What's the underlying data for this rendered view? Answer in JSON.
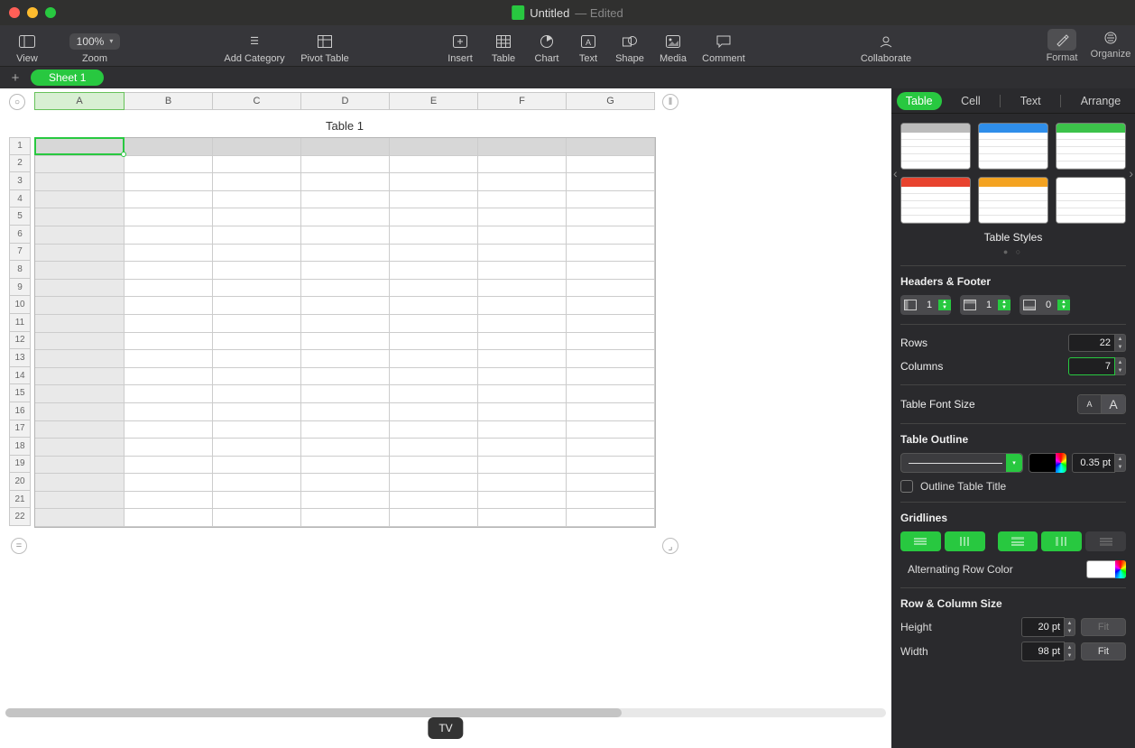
{
  "titlebar": {
    "doc_name": "Untitled",
    "status": "— Edited"
  },
  "toolbar": {
    "view": "View",
    "zoom_label": "Zoom",
    "zoom_value": "100%",
    "add_category": "Add Category",
    "pivot_table": "Pivot Table",
    "insert": "Insert",
    "table": "Table",
    "chart": "Chart",
    "text": "Text",
    "shape": "Shape",
    "media": "Media",
    "comment": "Comment",
    "collaborate": "Collaborate",
    "format": "Format",
    "organize": "Organize"
  },
  "sheets": {
    "active": "Sheet 1"
  },
  "spreadsheet": {
    "title": "Table 1",
    "columns": [
      "A",
      "B",
      "C",
      "D",
      "E",
      "F",
      "G"
    ],
    "row_count": 22
  },
  "inspector": {
    "tabs": {
      "table": "Table",
      "cell": "Cell",
      "text": "Text",
      "arrange": "Arrange"
    },
    "table_styles_caption": "Table Styles",
    "headers_footer": {
      "label": "Headers & Footer",
      "header_cols": "1",
      "header_rows": "1",
      "footer_rows": "0"
    },
    "rows": {
      "label": "Rows",
      "value": "22"
    },
    "columns": {
      "label": "Columns",
      "value": "7"
    },
    "font_size_label": "Table Font Size",
    "font_small": "A",
    "font_large": "A",
    "outline": {
      "label": "Table Outline",
      "pt": "0.35 pt",
      "title_check": "Outline Table Title"
    },
    "gridlines_label": "Gridlines",
    "alt_row": {
      "label": "Alternating Row Color"
    },
    "row_col_size": {
      "label": "Row & Column Size",
      "height_label": "Height",
      "height_value": "20 pt",
      "height_fit": "Fit",
      "width_label": "Width",
      "width_value": "98 pt",
      "width_fit": "Fit"
    }
  },
  "dock": {
    "tooltip": "TV"
  }
}
